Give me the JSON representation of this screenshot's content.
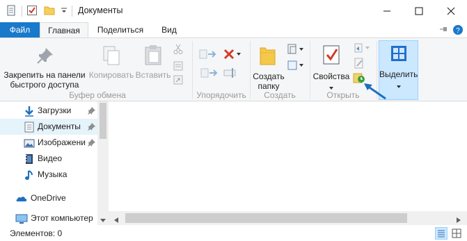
{
  "window": {
    "title": "Документы",
    "minimize_icon": "minimize-icon",
    "maximize_icon": "maximize-icon",
    "close_icon": "close-icon"
  },
  "tabs": [
    {
      "label": "Файл"
    },
    {
      "label": "Главная"
    },
    {
      "label": "Поделиться"
    },
    {
      "label": "Вид"
    }
  ],
  "ribbon": {
    "pin_label": "Закрепить на панели быстрого доступа",
    "pin_line1": "Закрепить на панели",
    "pin_line2": "быстрого доступа",
    "copy_label": "Копировать",
    "paste_label": "Вставить",
    "new_folder_line1": "Создать",
    "new_folder_line2": "папку",
    "properties_label": "Свойства",
    "select_label": "Выделить",
    "groups": {
      "clipboard": "Буфер обмена",
      "organize": "Упорядочить",
      "create": "Создать",
      "open": "Открыть"
    }
  },
  "nav": [
    {
      "label": "Загрузки",
      "icon": "downloads-icon",
      "pinned": true
    },
    {
      "label": "Документы",
      "icon": "documents-icon",
      "pinned": true,
      "selected": true
    },
    {
      "label": "Изображени",
      "icon": "pictures-icon",
      "pinned": true
    },
    {
      "label": "Видео",
      "icon": "video-icon"
    },
    {
      "label": "Музыка",
      "icon": "music-icon"
    },
    {
      "label": "OneDrive",
      "icon": "onedrive-icon"
    },
    {
      "label": "Этот компьютер",
      "icon": "this-pc-icon"
    }
  ],
  "status": {
    "items_text": "Элементов: 0"
  },
  "colors": {
    "accent": "#1979ca",
    "selected_nav": "#e5f3fb",
    "ribbon_bg": "#f5f6f7"
  }
}
